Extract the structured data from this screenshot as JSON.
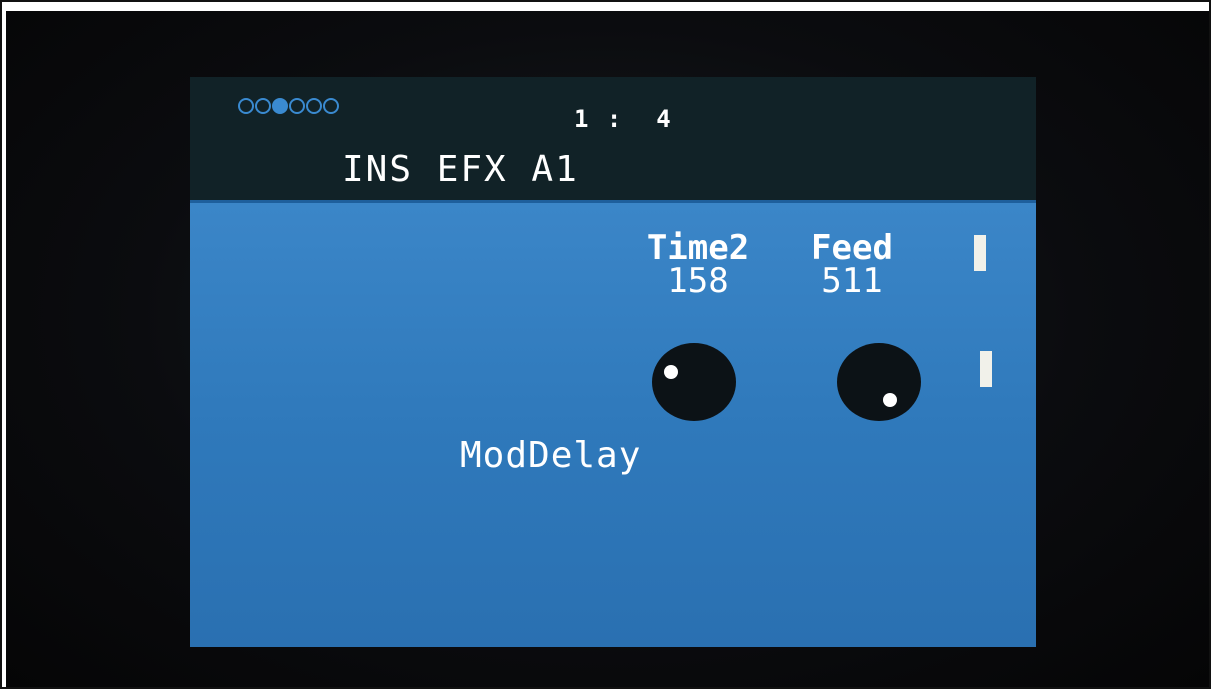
{
  "screen": {
    "page_indicator": {
      "count": 6,
      "active_index": 3
    },
    "position": "1 :  4",
    "title": "INS EFX A1",
    "params": [
      {
        "label": "Time2",
        "value": "158"
      },
      {
        "label": "Feed",
        "value": "511"
      }
    ],
    "effect_name": "ModDelay"
  },
  "colors": {
    "screen_blue": "#2c73b4",
    "topbar": "#112227",
    "accent_dot": "#3a8ad0",
    "text": "#ffffff"
  }
}
